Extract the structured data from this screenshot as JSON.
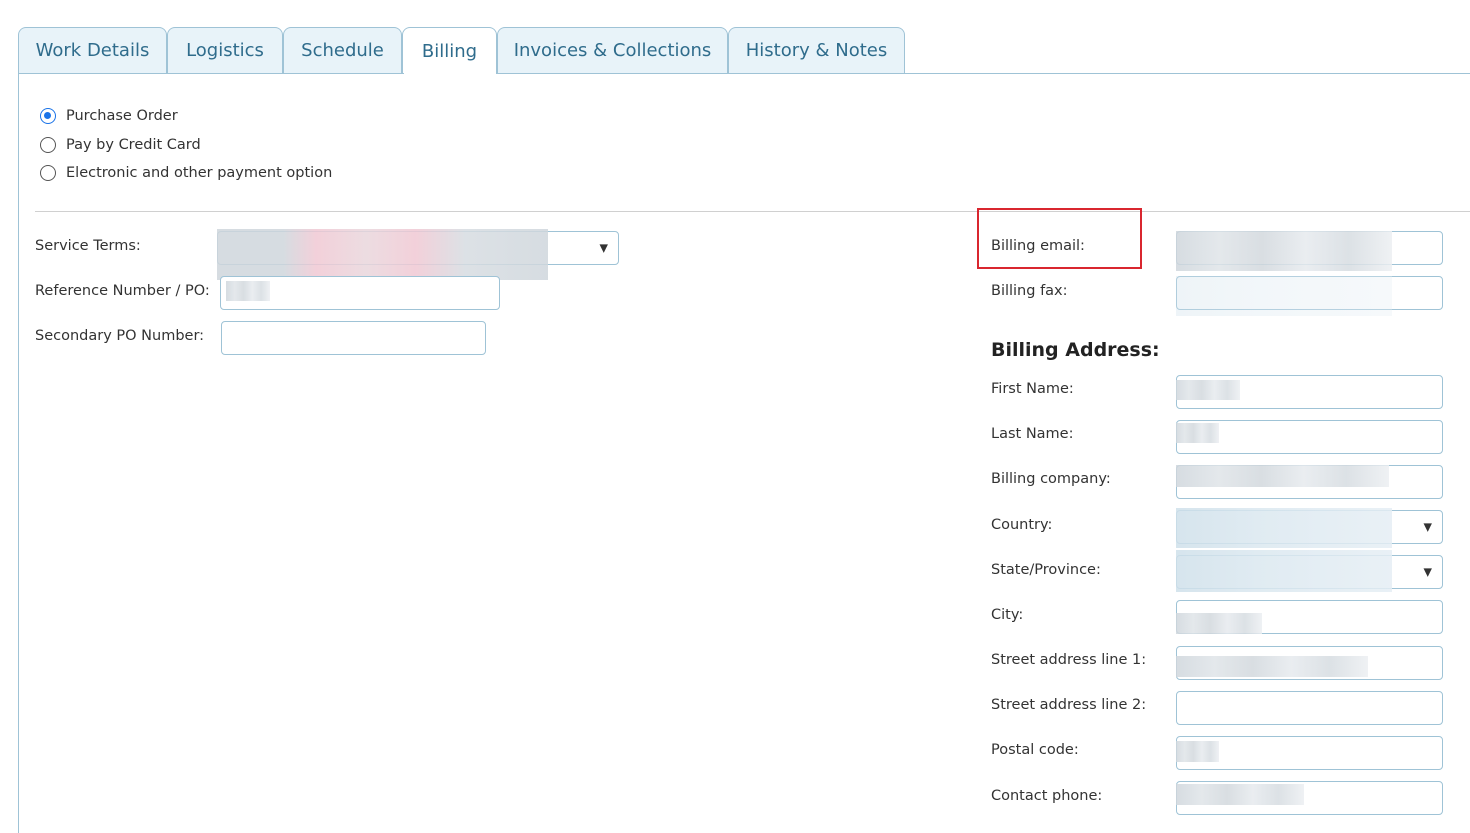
{
  "tabs": [
    {
      "label": "Work Details"
    },
    {
      "label": "Logistics"
    },
    {
      "label": "Schedule"
    },
    {
      "label": "Billing",
      "active": true
    },
    {
      "label": "Invoices & Collections"
    },
    {
      "label": "History & Notes"
    }
  ],
  "payment_options": [
    {
      "label": "Purchase Order",
      "selected": true
    },
    {
      "label": "Pay by Credit Card",
      "selected": false
    },
    {
      "label": "Electronic and other payment option",
      "selected": false
    }
  ],
  "left_form": {
    "service_terms_label": "Service Terms:",
    "reference_label": "Reference Number / PO:",
    "secondary_po_label": "Secondary PO Number:"
  },
  "right_form": {
    "billing_email_label": "Billing email:",
    "billing_fax_label": "Billing fax:",
    "billing_address_title": "Billing Address:",
    "first_name_label": "First Name:",
    "last_name_label": "Last Name:",
    "billing_company_label": "Billing company:",
    "country_label": "Country:",
    "state_label": "State/Province:",
    "city_label": "City:",
    "street1_label": "Street address line 1:",
    "street2_label": "Street address line 2:",
    "postal_label": "Postal code:",
    "phone_label": "Contact phone:"
  },
  "icons": {
    "dropdown": "chevron-down-icon"
  },
  "colors": {
    "accent": "#1a73e8",
    "tab_border": "#9fc3d6",
    "highlight": "#d9262f"
  }
}
